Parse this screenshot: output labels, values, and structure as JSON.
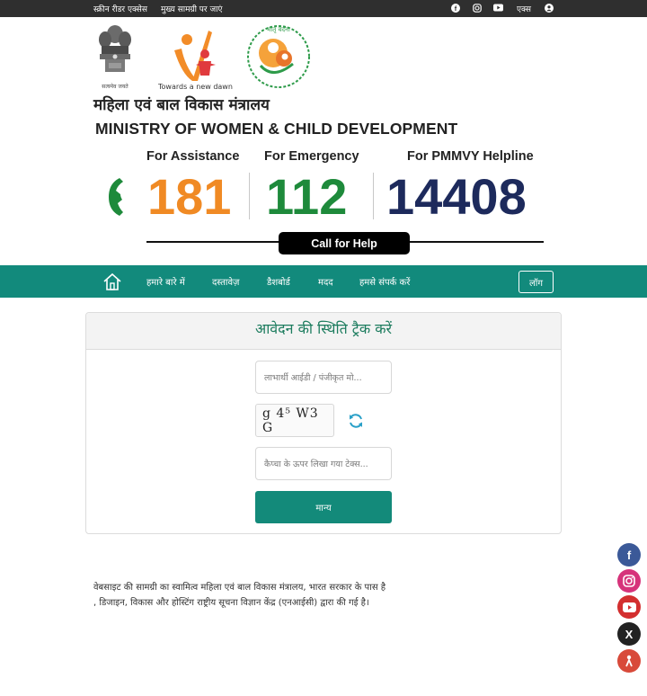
{
  "topbar": {
    "screen_reader": "स्क्रीन रीडर एक्सेस",
    "skip_main": "मुख्य सामग्री पर जाएं",
    "x_label": "एक्स",
    "icons": [
      "facebook-icon",
      "instagram-icon",
      "youtube-icon",
      "user-icon"
    ]
  },
  "header": {
    "emblem_caption": "सत्यमेव जयते",
    "wcd_tagline": "Towards a new dawn",
    "title_hindi": "महिला एवं बाल विकास मंत्रालय",
    "title_english": "MINISTRY OF WOMEN & CHILD DEVELOPMENT"
  },
  "helplines": [
    {
      "label": "For Assistance",
      "number": "181",
      "color": "#f08a24"
    },
    {
      "label": "For Emergency",
      "number": "112",
      "color": "#1e8a3b"
    },
    {
      "label": "For PMMVY Helpline",
      "number": "14408",
      "color": "#1d2a5c"
    }
  ],
  "call_button": "Call for Help",
  "nav": {
    "items": [
      "हमारे बारे में",
      "दस्तावेज़",
      "डैशबोर्ड",
      "मदद",
      "हमसे संपर्क करें"
    ],
    "login": "लॉग",
    "bg": "#128a7c"
  },
  "form": {
    "title": "आवेदन की स्थिति ट्रैक करें",
    "beneficiary_placeholder": "लाभार्थी आईडी / पंजीकृत मो...",
    "captcha_text": "g 4⁵ W3 G",
    "captcha_input_placeholder": "कैप्चा के ऊपर लिखा गया टेक्स...",
    "submit_label": "मान्य"
  },
  "footer": {
    "line1": "वेबसाइट की सामग्री का स्वामित्व महिला एवं बाल विकास मंत्रालय, भारत सरकार के पास है",
    "line2": ", डिजाइन, विकास और होस्टिंग राष्ट्रीय सूचना विज्ञान केंद्र (एनआईसी) द्वारा की गई है।"
  },
  "social": [
    {
      "name": "facebook",
      "glyph": "f",
      "color": "#3b5998"
    },
    {
      "name": "instagram",
      "glyph": "◎",
      "color": "#d6337a"
    },
    {
      "name": "youtube",
      "glyph": "▶",
      "color": "#d32f2f"
    },
    {
      "name": "x",
      "glyph": "X",
      "color": "#222222"
    },
    {
      "name": "koo",
      "glyph": "k",
      "color": "#d84a3a"
    }
  ]
}
